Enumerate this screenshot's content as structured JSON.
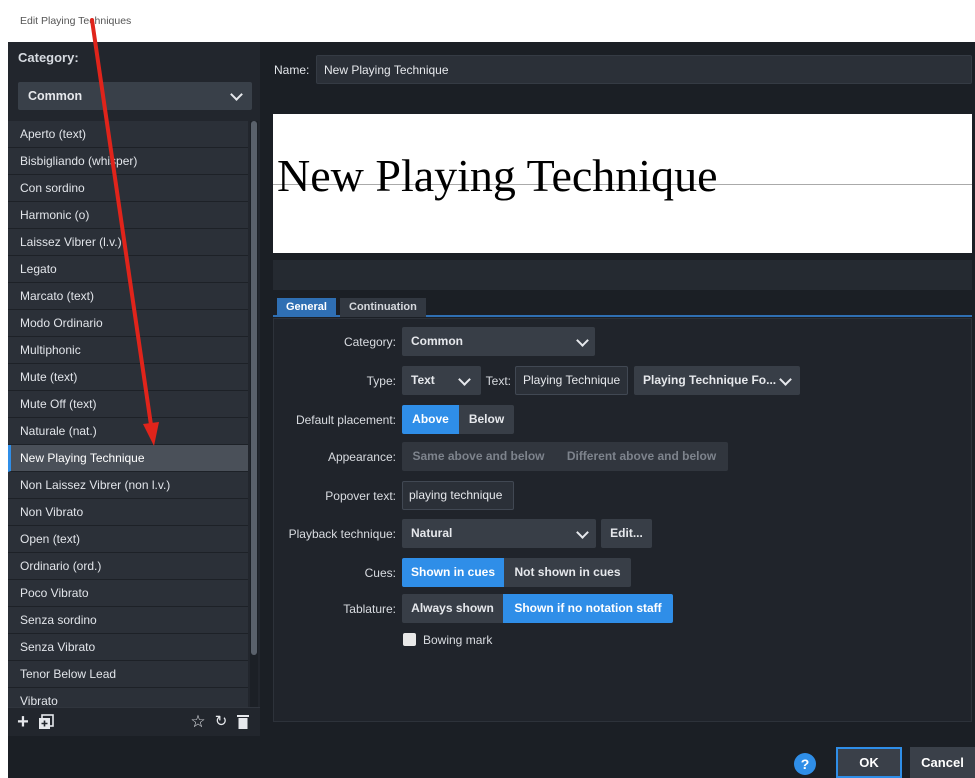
{
  "window": {
    "title": "Edit Playing Techniques"
  },
  "left_panel": {
    "category_label": "Category:",
    "category_value": "Common",
    "items": [
      "Aperto (text)",
      "Bisbigliando (whisper)",
      "Con sordino",
      "Harmonic (o)",
      "Laissez Vibrer (l.v.)",
      "Legato",
      "Marcato (text)",
      "Modo Ordinario",
      "Multiphonic",
      "Mute (text)",
      "Mute Off (text)",
      "Naturale (nat.)",
      "New Playing Technique",
      "Non Laissez Vibrer (non l.v.)",
      "Non Vibrato",
      "Open (text)",
      "Ordinario (ord.)",
      "Poco Vibrato",
      "Senza sordino",
      "Senza Vibrato",
      "Tenor Below Lead",
      "Vibrato"
    ],
    "selected_index": 12,
    "footer_icons": [
      "add-icon",
      "duplicate-icon",
      "star-icon",
      "reset-icon",
      "delete-icon"
    ]
  },
  "editor": {
    "name_label": "Name:",
    "name_value": "New Playing Technique",
    "preview_text": "New Playing Technique",
    "tabs": [
      "General",
      "Continuation"
    ],
    "active_tab": "General",
    "fields": {
      "category_label": "Category:",
      "category_value": "Common",
      "type_label": "Type:",
      "type_value": "Text",
      "text_label": "Text:",
      "text_value": "Playing Technique",
      "font_value": "Playing Technique Fo...",
      "placement_label": "Default placement:",
      "placement_options": [
        "Above",
        "Below"
      ],
      "placement_selected": "Above",
      "appearance_label": "Appearance:",
      "appearance_options": [
        "Same above and below",
        "Different above and below"
      ],
      "popover_label": "Popover text:",
      "popover_value": "playing technique",
      "playback_label": "Playback technique:",
      "playback_value": "Natural",
      "edit_label": "Edit...",
      "cues_label": "Cues:",
      "cues_options": [
        "Shown in cues",
        "Not shown in cues"
      ],
      "cues_selected": "Shown in cues",
      "tablature_label": "Tablature:",
      "tablature_options": [
        "Always shown",
        "Shown if no notation staff"
      ],
      "tablature_selected": "Shown if no notation staff",
      "bowing_label": "Bowing mark",
      "bowing_checked": false
    }
  },
  "buttons": {
    "help": "?",
    "ok": "OK",
    "cancel": "Cancel"
  },
  "colors": {
    "accent": "#2f8ee8",
    "annotation_arrow": "#e0241b",
    "background": "#1b1f25"
  }
}
